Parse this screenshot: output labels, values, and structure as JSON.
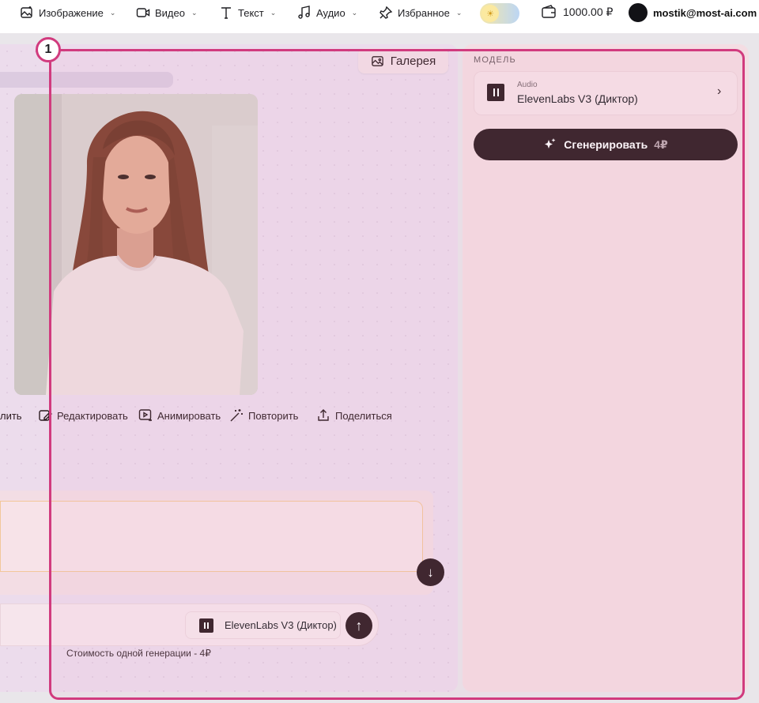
{
  "navbar": {
    "items": [
      {
        "label": "Изображение",
        "icon": "image-sparkle-icon"
      },
      {
        "label": "Видео",
        "icon": "video-icon"
      },
      {
        "label": "Текст",
        "icon": "text-icon"
      },
      {
        "label": "Аудио",
        "icon": "music-note-icon"
      },
      {
        "label": "Избранное",
        "icon": "pin-icon"
      }
    ],
    "balance": "1000.00 ₽",
    "account_email": "mostik@most-ai.com"
  },
  "gallery": {
    "label": "Галерея"
  },
  "actions": {
    "delete_partial": "лить",
    "edit": "Редактировать",
    "animate": "Анимировать",
    "repeat": "Повторить",
    "share": "Поделиться"
  },
  "composer": {
    "model_label": "ElevenLabs V3 (Диктор)",
    "cost_note": "Стоимость одной генерации - 4₽"
  },
  "sidebar": {
    "section_label": "МОДЕЛЬ",
    "model": {
      "category": "Audio",
      "name": "ElevenLabs V3 (Диктор)"
    },
    "generate_label": "Сгенерировать",
    "generate_cost": "4₽"
  },
  "annotation": {
    "badge": "1"
  },
  "colors": {
    "accent_dark": "#2d1a20",
    "annotation": "#d13b7e",
    "panel": "#f4dde3"
  }
}
